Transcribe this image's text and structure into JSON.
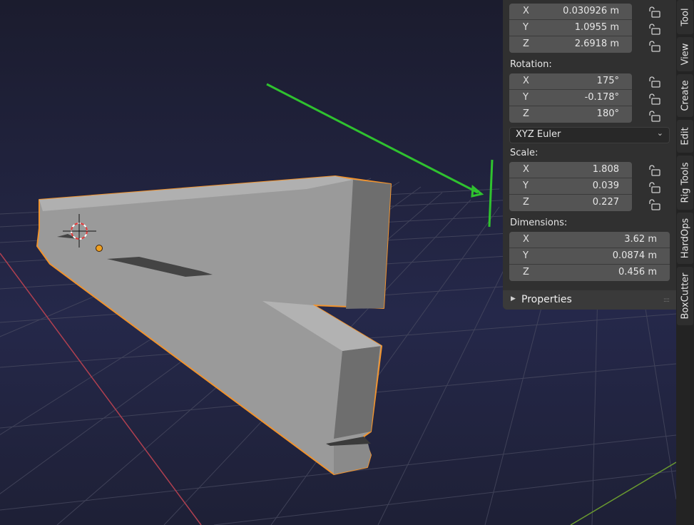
{
  "location": {
    "rows": [
      {
        "axis": "X",
        "value": "0.030926 m"
      },
      {
        "axis": "Y",
        "value": "1.0955 m"
      },
      {
        "axis": "Z",
        "value": "2.6918 m"
      }
    ]
  },
  "rotation": {
    "label": "Rotation:",
    "rows": [
      {
        "axis": "X",
        "value": "175°"
      },
      {
        "axis": "Y",
        "value": "-0.178°"
      },
      {
        "axis": "Z",
        "value": "180°"
      }
    ],
    "mode": "XYZ Euler"
  },
  "scale": {
    "label": "Scale:",
    "rows": [
      {
        "axis": "X",
        "value": "1.808"
      },
      {
        "axis": "Y",
        "value": "0.039"
      },
      {
        "axis": "Z",
        "value": "0.227"
      }
    ]
  },
  "dimensions": {
    "label": "Dimensions:",
    "rows": [
      {
        "axis": "X",
        "value": "3.62 m"
      },
      {
        "axis": "Y",
        "value": "0.0874 m"
      },
      {
        "axis": "Z",
        "value": "0.456 m"
      }
    ]
  },
  "properties_label": "Properties",
  "tabs": [
    "Tool",
    "View",
    "Create",
    "Edit",
    "Rig Tools",
    "HardOps",
    "BoxCutter"
  ],
  "colors": {
    "selection_outline": "#f0932e",
    "annotation": "#2fc22f",
    "x_axis": "#b04050",
    "y_axis": "#6a9a30"
  },
  "icons": [
    "lock-icon",
    "chevron-down-icon",
    "disclosure-triangle-icon",
    "3d-cursor-icon",
    "object-origin-icon"
  ]
}
